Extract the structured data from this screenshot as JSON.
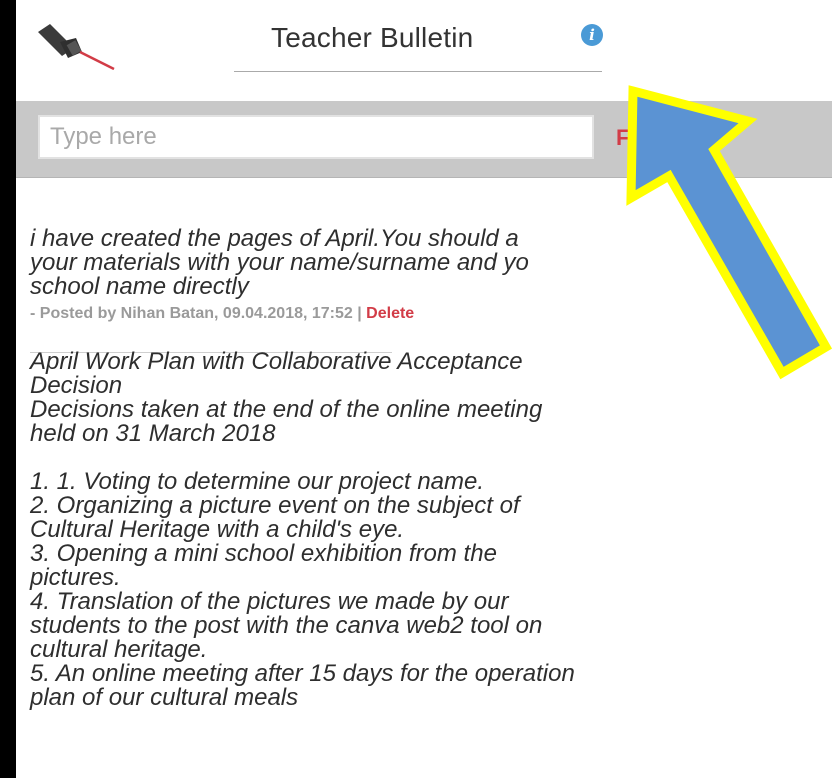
{
  "header": {
    "title": "Teacher Bulletin",
    "info_icon": "i"
  },
  "composer": {
    "placeholder": "Type here",
    "post_glyph": "F"
  },
  "posts": [
    {
      "text": "i have created the pages of April.You should a\nyour materials with your name/surname and yo\nschool name directly",
      "meta_prefix": "- Posted by Nihan Batan, 09.04.2018, 17:52 | ",
      "delete_label": "Delete"
    },
    {
      "text": "April Work Plan with Collaborative Acceptance\nDecision\nDecisions taken at the end of the online meeting\nheld on 31 March 2018\n\n1. 1. Voting to determine our project name.\n2. Organizing a picture event on the subject of\nCultural Heritage with a child's eye.\n3. Opening a mini school exhibition from the\npictures.\n4. Translation of the pictures we made by our\nstudents to the post with the canva web2 tool on\ncultural heritage.\n5. An online meeting after 15 days for the operation\nplan of our cultural meals"
    }
  ],
  "colors": {
    "accent_red": "#d23c47",
    "info_blue": "#4a9ad6",
    "toolbar_gray": "#c8c8c8",
    "arrow_blue": "#5b93d3",
    "arrow_outline": "#ffff00"
  }
}
